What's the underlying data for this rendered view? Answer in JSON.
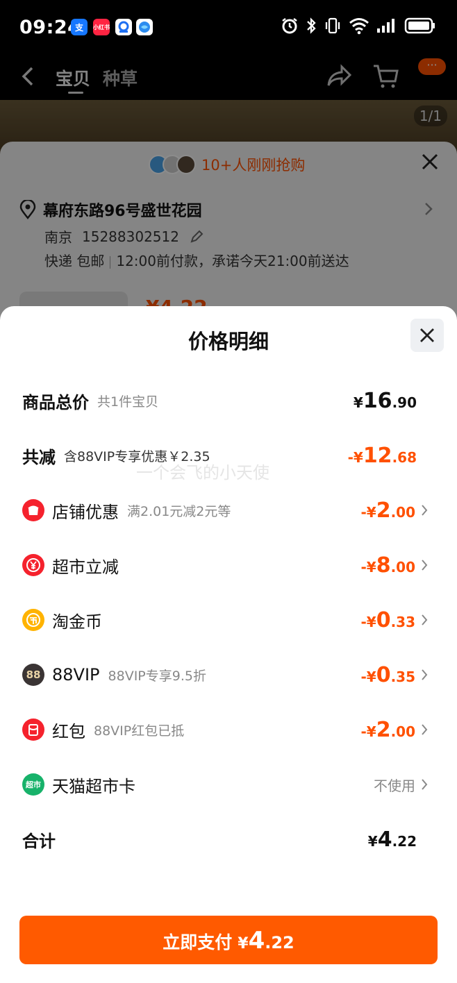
{
  "status_bar": {
    "time": "09:24",
    "app_icons": [
      "alipay-icon",
      "xiaohongshu-icon",
      "app-blue-icon",
      "browser-icon"
    ],
    "app_label_alipay": "支",
    "app_label_xhs": "小红书"
  },
  "header": {
    "tab_baobei": "宝贝",
    "tab_zhongcao": "种草",
    "msg_badge": "···"
  },
  "product": {
    "image_counter": "1/1"
  },
  "order_sheet": {
    "buyers_text": "10+人刚刚抢购",
    "address": "幕府东路96号盛世花园",
    "city": "南京",
    "phone": "15288302512",
    "delivery_type": "快递 包邮",
    "delivery_promise": "12:00前付款，承诺今天21:00前送达",
    "peek_price": "¥4.22"
  },
  "price_detail": {
    "title": "价格明细",
    "watermark": "一个会飞的小天使",
    "rows": [
      {
        "label": "商品总价",
        "sub": "共1件宝贝",
        "sign": "",
        "sym": "¥",
        "int": "16",
        "dec": ".90"
      },
      {
        "label": "共减",
        "sub": "含88VIP专享优惠￥2.35",
        "sign": "-",
        "sym": "¥",
        "int": "12",
        "dec": ".68"
      },
      {
        "label": "店铺优惠",
        "sub": "满2.01元减2元等",
        "sign": "-",
        "sym": "¥",
        "int": "2",
        "dec": ".00"
      },
      {
        "label": "超市立减",
        "sub": "",
        "sign": "-",
        "sym": "¥",
        "int": "8",
        "dec": ".00"
      },
      {
        "label": "淘金币",
        "sub": "",
        "sign": "-",
        "sym": "¥",
        "int": "0",
        "dec": ".33"
      },
      {
        "label": "88VIP",
        "sub": "88VIP专享9.5折",
        "sign": "-",
        "sym": "¥",
        "int": "0",
        "dec": ".35"
      },
      {
        "label": "红包",
        "sub": "88VIP红包已抵",
        "sign": "-",
        "sym": "¥",
        "int": "2",
        "dec": ".00"
      },
      {
        "label": "天猫超市卡",
        "value": "不使用"
      },
      {
        "label": "合计",
        "sign": "",
        "sym": "¥",
        "int": "4",
        "dec": ".22"
      }
    ],
    "icon_texts": {
      "vip": "88",
      "supermarket_card": "超市"
    }
  },
  "pay_button": {
    "label": "立即支付",
    "sym": "¥",
    "int": "4",
    "dec": ".22"
  },
  "colors": {
    "accent": "#ff5000",
    "pay": "#ff5a00",
    "shop_red": "#f5222d",
    "coin_yellow": "#ffb300",
    "vip_dark": "#3a3434",
    "card_green": "#17b26a"
  }
}
